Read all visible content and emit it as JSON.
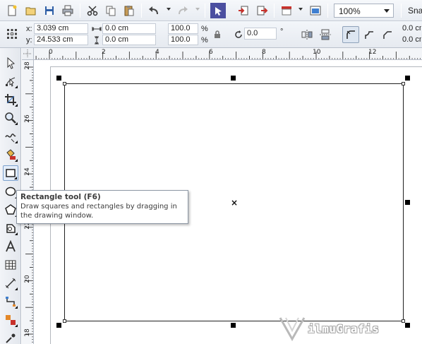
{
  "toolbar": {
    "zoom_value": "100%",
    "snap_label": "Sna"
  },
  "property_bar": {
    "x_label": "x:",
    "x_value": "3.039 cm",
    "y_label": "y:",
    "y_value": "24.533 cm",
    "width_value": "0.0 cm",
    "height_value": "0.0 cm",
    "scale_w_value": "100.0",
    "scale_h_value": "100.0",
    "percent_sign": "%",
    "rotation_value": "0.0",
    "degree_sign": "°",
    "corner_radius_top": "0.0 cm",
    "corner_radius_bottom": "0.0 cm"
  },
  "rulers": {
    "horizontal_labels": [
      "0",
      "2",
      "4",
      "6",
      "8",
      "10",
      "12"
    ],
    "vertical_labels": [
      "28",
      "26",
      "24",
      "22",
      "20",
      "18"
    ]
  },
  "tooltip": {
    "title": "Rectangle tool (F6)",
    "body": "Draw squares and rectangles by dragging in the drawing window."
  },
  "watermark": {
    "text": "ilmuGrafis"
  },
  "colors": {
    "accent_red": "#c8312b",
    "accent_blue": "#3f7fd0",
    "icon_gray": "#4a4a4a"
  }
}
